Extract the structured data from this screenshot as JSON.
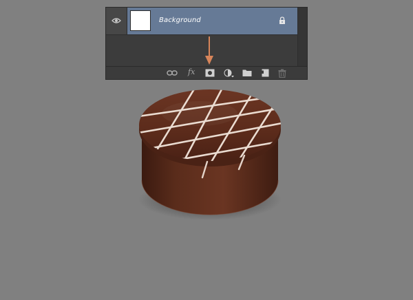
{
  "layers": {
    "items": [
      {
        "name": "Background",
        "locked": true,
        "visible": true,
        "thumbnail_color": "#ffffff"
      }
    ],
    "footer_icons": [
      "link-layers-icon",
      "fx-layer-style-icon",
      "add-layer-mask-icon",
      "adjustment-layer-icon",
      "new-group-icon",
      "new-layer-icon",
      "delete-layer-icon"
    ],
    "fx_text": "fx"
  },
  "annotation": {
    "arrow_color": "#d8855a",
    "points_to": "add-layer-mask-icon"
  },
  "colors": {
    "canvas_bg": "#808080",
    "panel_bg": "#3f3f3f",
    "selected_row": "#667a96",
    "chocolate": "#5a2e1d"
  }
}
